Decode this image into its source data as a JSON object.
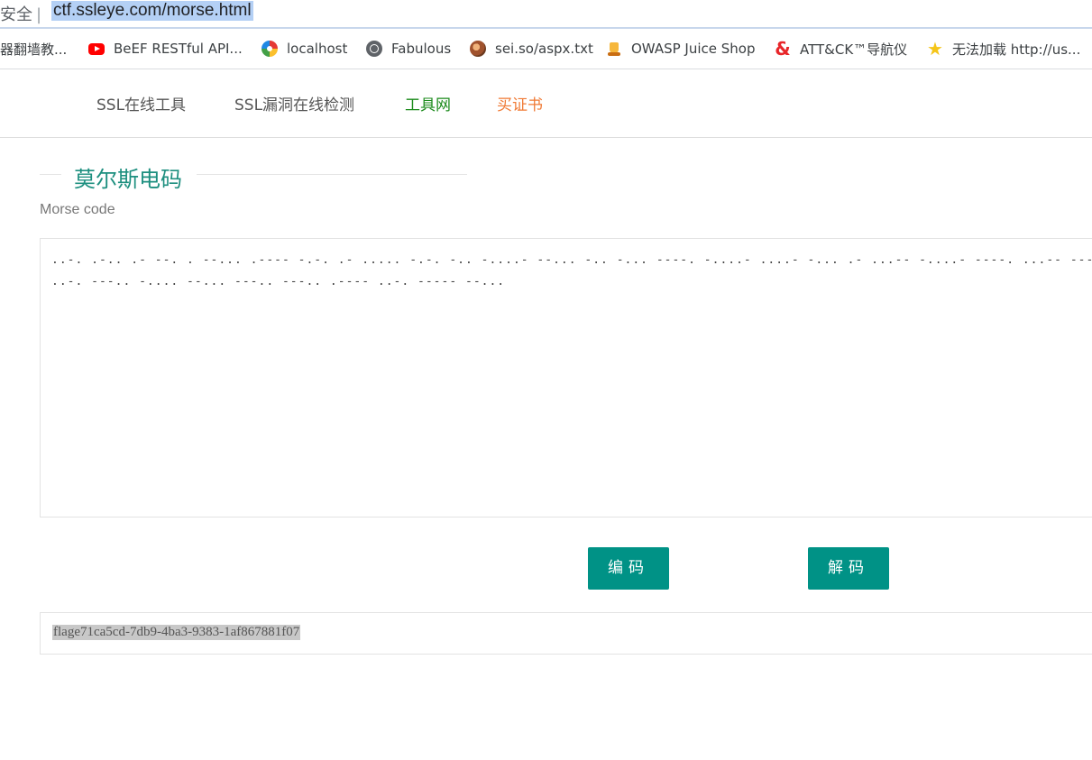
{
  "browser": {
    "insecure_label": "安全",
    "separator": "|",
    "url": "ctf.ssleye.com/morse.html"
  },
  "bookmarks": [
    {
      "label": "器翻墙教...",
      "icon": "none"
    },
    {
      "label": "BeEF RESTful API...",
      "icon": "youtube-icon"
    },
    {
      "label": "localhost",
      "icon": "localhost-icon"
    },
    {
      "label": "Fabulous",
      "icon": "globe-icon"
    },
    {
      "label": "sei.so/aspx.txt",
      "icon": "sei-icon"
    },
    {
      "label": "OWASP Juice Shop",
      "icon": "juice-icon"
    },
    {
      "label": "ATT&CK™导航仪",
      "icon": "ampersand-icon"
    },
    {
      "label": "无法加载 http://us...",
      "icon": "star-icon"
    }
  ],
  "nav": [
    {
      "label": "SSL在线工具",
      "color": "#555555"
    },
    {
      "label": "SSL漏洞在线检测",
      "color": "#555555"
    },
    {
      "label": "工具网",
      "color": "#1a8a1a"
    },
    {
      "label": "买证书",
      "color": "#f07a35"
    }
  ],
  "page": {
    "title": "莫尔斯电码",
    "subtitle": "Morse code"
  },
  "morse": {
    "line1": "..-. .-.. .- --. . --... .---- -.-. .- ..... -.-. -.. -....- --... -.. -... ----. -....- ....- -... .- ...-- -....- ----. ...-- ---.. ...-- -....- .---- .- ..-.",
    "line2": "..-. ---.. -.... --... ---.. ---.. .---- ..-. ----- --..."
  },
  "buttons": {
    "encode": "编码",
    "decode": "解码"
  },
  "result": {
    "text": "flage71ca5cd-7db9-4ba3-9383-1af867881f07"
  },
  "colors": {
    "accent": "#009286",
    "title": "#1d8f7f",
    "url_highlight": "#b4d0f5"
  }
}
